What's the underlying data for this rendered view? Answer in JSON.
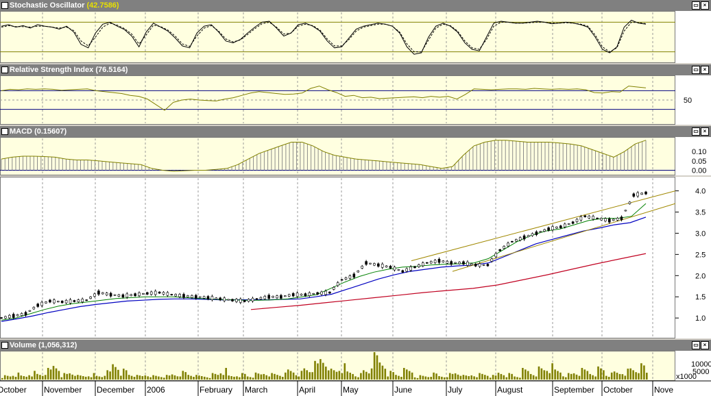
{
  "panels": {
    "stochastic": {
      "title": "Stochastic Oscillator",
      "value": "(42.7586)"
    },
    "rsi": {
      "title": "Relative Strength Index",
      "value": "(76.5164)"
    },
    "macd": {
      "title": "MACD",
      "value": "(0.15607)"
    },
    "volume": {
      "title": "Volume",
      "value": "(1,056,312)"
    }
  },
  "colors": {
    "price": "#000000",
    "ma_short": "#008000",
    "ma_mid": "#0000c0",
    "ma_long": "#c00020",
    "channel": "#a08800",
    "indicator": "#808000",
    "volume": "#808000",
    "signal_line": "#000000"
  },
  "chart_data": [
    {
      "type": "line",
      "panel": "Stochastic Oscillator",
      "ylim": [
        0,
        100
      ],
      "reference_lines": [
        80,
        20
      ],
      "series": [
        {
          "values": [
            72,
            75,
            70,
            73,
            68,
            75,
            72,
            70,
            66,
            72,
            60,
            35,
            28,
            58,
            76,
            80,
            72,
            65,
            52,
            30,
            60,
            78,
            70,
            62,
            48,
            32,
            28,
            58,
            72,
            75,
            60,
            42,
            38,
            45,
            58,
            70,
            80,
            82,
            68,
            52,
            58,
            75,
            78,
            72,
            62,
            42,
            28,
            30,
            48,
            66,
            72,
            75,
            78,
            76,
            72,
            58,
            30,
            15,
            18,
            50,
            72,
            78,
            72,
            60,
            38,
            25,
            22,
            50,
            78,
            82,
            80,
            78,
            78,
            80,
            82,
            80,
            77,
            78,
            80,
            78,
            75,
            70,
            50,
            25,
            18,
            30,
            70,
            84,
            78,
            76
          ]
        },
        {
          "values": [
            70,
            73,
            71,
            71,
            70,
            72,
            72,
            70,
            68,
            70,
            63,
            42,
            32,
            50,
            70,
            78,
            74,
            67,
            56,
            36,
            54,
            74,
            71,
            64,
            52,
            36,
            31,
            52,
            68,
            73,
            62,
            46,
            40,
            44,
            55,
            67,
            77,
            80,
            70,
            56,
            58,
            72,
            76,
            73,
            64,
            46,
            32,
            32,
            45,
            62,
            70,
            73,
            76,
            76,
            72,
            60,
            36,
            20,
            20,
            44,
            68,
            76,
            73,
            62,
            42,
            28,
            25,
            45,
            72,
            80,
            80,
            78,
            78,
            79,
            80,
            80,
            78,
            78,
            79,
            78,
            76,
            72,
            54,
            30,
            20,
            28,
            62,
            80,
            79,
            77
          ]
        }
      ]
    },
    {
      "type": "line",
      "panel": "Relative Strength Index",
      "ylim": [
        0,
        100
      ],
      "ytick_labels": [
        "50"
      ],
      "reference_lines": [
        70,
        30
      ],
      "series": [
        {
          "values": [
            70,
            73,
            72,
            74,
            73,
            74,
            73,
            71,
            72,
            73,
            74,
            70,
            68,
            66,
            64,
            60,
            58,
            52,
            40,
            28,
            45,
            50,
            52,
            50,
            49,
            48,
            52,
            55,
            60,
            65,
            68,
            66,
            64,
            62,
            63,
            65,
            75,
            80,
            72,
            66,
            58,
            60,
            55,
            56,
            53,
            54,
            55,
            56,
            57,
            55,
            58,
            56,
            58,
            52,
            62,
            74,
            73,
            72,
            73,
            74,
            74,
            73,
            75,
            74,
            73,
            74,
            73,
            74,
            72,
            66,
            65,
            68,
            67,
            80,
            78,
            76
          ]
        }
      ]
    },
    {
      "type": "bar",
      "panel": "MACD",
      "ytick_labels": [
        "0.10",
        "0.05",
        "0.00"
      ],
      "ylim": [
        -0.02,
        0.17
      ],
      "series": [
        {
          "values": [
            0.06,
            0.07,
            0.075,
            0.075,
            0.073,
            0.07,
            0.06,
            0.055,
            0.055,
            0.05,
            0.045,
            0.04,
            0.035,
            0.03,
            0.01,
            0.0,
            -0.005,
            -0.003,
            0.0,
            0.0,
            0.005,
            0.01,
            0.03,
            0.06,
            0.09,
            0.11,
            0.13,
            0.15,
            0.15,
            0.13,
            0.1,
            0.08,
            0.07,
            0.06,
            0.055,
            0.05,
            0.045,
            0.04,
            0.035,
            0.03,
            0.02,
            0.01,
            0.02,
            0.08,
            0.13,
            0.15,
            0.16,
            0.16,
            0.155,
            0.15,
            0.15,
            0.15,
            0.145,
            0.14,
            0.13,
            0.11,
            0.09,
            0.07,
            0.1,
            0.14,
            0.16
          ]
        }
      ]
    },
    {
      "type": "line",
      "panel": "Price",
      "ytick_labels": [
        "4.0",
        "3.5",
        "3.0",
        "2.5",
        "2.0",
        "1.5",
        "1.0"
      ],
      "ylim": [
        0.55,
        4.3
      ],
      "x": [
        "October",
        "November",
        "December",
        "2006",
        "February",
        "March",
        "April",
        "May",
        "June",
        "July",
        "August",
        "September",
        "October",
        "Nove"
      ],
      "series": [
        {
          "values": [
            1.0,
            1.05,
            1.1,
            1.3,
            1.4,
            1.38,
            1.4,
            1.42,
            1.6,
            1.55,
            1.52,
            1.55,
            1.58,
            1.6,
            1.55,
            1.52,
            1.5,
            1.48,
            1.45,
            1.42,
            1.4,
            1.45,
            1.5,
            1.5,
            1.55,
            1.55,
            1.58,
            1.6,
            1.9,
            2.0,
            2.3,
            2.25,
            2.2,
            2.1,
            2.2,
            2.3,
            2.35,
            2.3,
            2.3,
            2.25,
            2.25,
            2.6,
            2.8,
            2.9,
            3.0,
            3.1,
            3.15,
            3.25,
            3.4,
            3.35,
            3.3,
            3.35,
            3.9,
            3.95
          ]
        },
        {
          "values": [
            0.95,
            1.0,
            1.1,
            1.2,
            1.28,
            1.34,
            1.38,
            1.42,
            1.46,
            1.48,
            1.5,
            1.5,
            1.5,
            1.48,
            1.46,
            1.44,
            1.43,
            1.42,
            1.42,
            1.43,
            1.45,
            1.5,
            1.55,
            1.7,
            1.85,
            1.98,
            2.08,
            2.15,
            2.2,
            2.22,
            2.25,
            2.27,
            2.28,
            2.3,
            2.4,
            2.6,
            2.8,
            2.95,
            3.05,
            3.1,
            3.2,
            3.3,
            3.35,
            3.35,
            3.4,
            3.7
          ]
        },
        {
          "values": [
            0.92,
            0.98,
            1.05,
            1.13,
            1.2,
            1.27,
            1.32,
            1.36,
            1.4,
            1.42,
            1.44,
            1.45,
            1.45,
            1.44,
            1.43,
            1.43,
            1.43,
            1.43,
            1.44,
            1.45,
            1.5,
            1.56,
            1.68,
            1.8,
            1.92,
            2.02,
            2.1,
            2.15,
            2.2,
            2.23,
            2.25,
            2.3,
            2.45,
            2.6,
            2.75,
            2.85,
            2.95,
            3.05,
            3.12,
            3.2,
            3.25,
            3.38
          ]
        },
        {
          "values": [
            1.2,
            1.25,
            1.3,
            1.36,
            1.42,
            1.48,
            1.54,
            1.6,
            1.65,
            1.7,
            1.78,
            1.9,
            2.02,
            2.15,
            2.28,
            2.4,
            2.52
          ]
        },
        {
          "values": [
            2.35,
            4.0
          ]
        },
        {
          "values": [
            2.1,
            3.7
          ]
        }
      ]
    },
    {
      "type": "bar",
      "panel": "Volume",
      "ytick_labels": [
        "10000",
        "5000"
      ],
      "ylabel": "x1000",
      "values": [
        2,
        3,
        2,
        4,
        3,
        5,
        8,
        3,
        4,
        2,
        3,
        2,
        4,
        9,
        5,
        3,
        2,
        3,
        2,
        2,
        3,
        4,
        3,
        2,
        2,
        3,
        5,
        2,
        3,
        2,
        3,
        4,
        3,
        3,
        5,
        4,
        6,
        8,
        12,
        5,
        7,
        4,
        3,
        5,
        12,
        10,
        4,
        3,
        5,
        2,
        2,
        3,
        2,
        3,
        4,
        2,
        3,
        3,
        2,
        4,
        3,
        2,
        5,
        4,
        6,
        7,
        5,
        3,
        4,
        5,
        4,
        6,
        3,
        4,
        5,
        6,
        7,
        4
      ]
    }
  ]
}
